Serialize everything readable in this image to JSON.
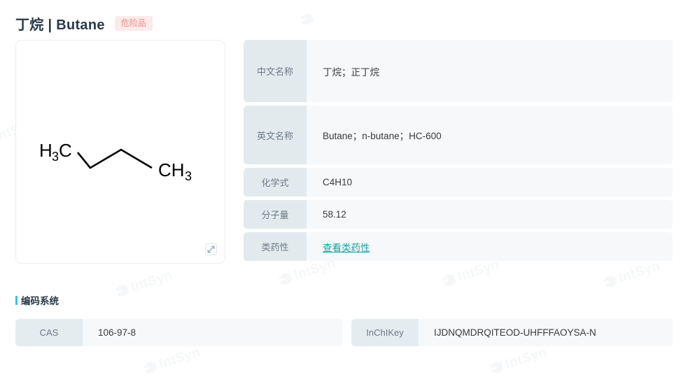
{
  "header": {
    "title": "丁烷 | Butane",
    "hazard_badge": "危险品"
  },
  "structure": {
    "left_label": "H3C",
    "left_label_main": "H",
    "left_label_sub": "3",
    "left_label_tail": "C",
    "right_label_main": "CH",
    "right_label_sub": "3",
    "expand_icon": "expand-icon"
  },
  "info_table": {
    "rows": [
      {
        "label": "中文名称",
        "value": "丁烷；正丁烷",
        "type": "text"
      },
      {
        "label": "英文名称",
        "value": "Butane；n-butane；HC-600",
        "type": "text"
      },
      {
        "label": "化学式",
        "value": "C4H10",
        "type": "text"
      },
      {
        "label": "分子量",
        "value": "58.12",
        "type": "text"
      },
      {
        "label": "类药性",
        "value": "查看类药性",
        "type": "link"
      }
    ]
  },
  "coding_section": {
    "title": "编码系统",
    "entries": [
      {
        "label": "CAS",
        "value": "106-97-8"
      },
      {
        "label": "InChIKey",
        "value": "IJDNQMDRQITEOD-UHFFFAOYSA-N"
      }
    ]
  },
  "watermark": {
    "text": "IntSyn"
  },
  "colors": {
    "title": "#2b3a4a",
    "badge_bg": "#fdeaea",
    "badge_text": "#f28b86",
    "label_bg": "#e3eaee",
    "value_bg": "#f6f8fa",
    "link": "#17a3a3",
    "accent_bar": "#31c5e0"
  }
}
